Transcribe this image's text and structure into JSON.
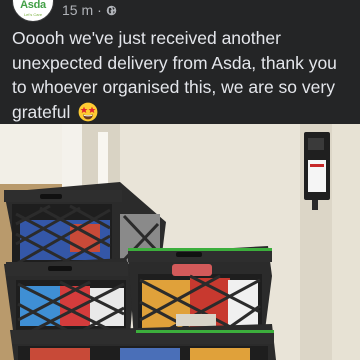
{
  "post": {
    "author_logo_text": "Asda",
    "author_logo_subtext": "Let's Care",
    "time": "15 m",
    "separator": "·",
    "privacy_icon": "globe-icon",
    "text": "Ooooh we've just received another unexpected delivery from Asda, thank you to whoever organised this, we are so very grateful",
    "emoji": "star-struck-emoji"
  },
  "colors": {
    "background": "#242526",
    "text": "#e4e6eb",
    "meta_text": "#b0b3b8",
    "crate": "#2b2b2b",
    "crate_rim": "#3cae3c",
    "wall": "#e6e0d2"
  }
}
